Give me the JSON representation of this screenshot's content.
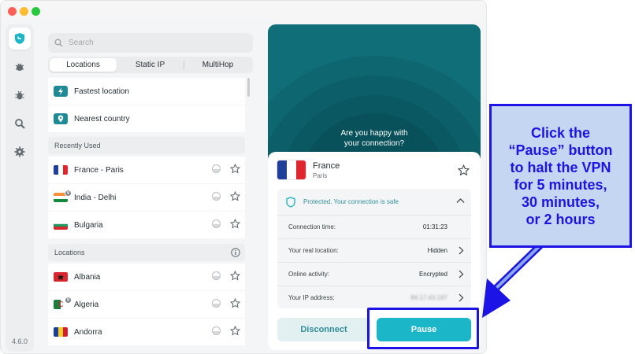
{
  "app": {
    "version": "4.6.0"
  },
  "search": {
    "placeholder": "Search",
    "value": ""
  },
  "tabs": [
    {
      "label": "Locations",
      "active": true
    },
    {
      "label": "Static IP",
      "active": false
    },
    {
      "label": "MultiHop",
      "active": false
    }
  ],
  "quick": [
    {
      "label": "Fastest location",
      "icon": "bolt-icon"
    },
    {
      "label": "Nearest country",
      "icon": "location-pin-icon"
    }
  ],
  "recently_used": {
    "header": "Recently Used",
    "items": [
      {
        "label": "France - Paris",
        "flag": "france-flag"
      },
      {
        "label": "India - Delhi",
        "flag": "india-flag",
        "virtual": "V"
      },
      {
        "label": "Bulgaria",
        "flag": "bulgaria-flag"
      }
    ]
  },
  "locations": {
    "header": "Locations",
    "items": [
      {
        "label": "Albania",
        "flag": "albania-flag"
      },
      {
        "label": "Algeria",
        "flag": "algeria-flag",
        "virtual": "V"
      },
      {
        "label": "Andorra",
        "flag": "andorra-flag"
      }
    ]
  },
  "hero": {
    "line1": "Are you happy with",
    "line2": "your connection?"
  },
  "connection": {
    "country": "France",
    "city": "Paris",
    "status": "Protected. Your connection is safe",
    "stats": [
      {
        "label": "Connection time:",
        "value": "01:31:23"
      },
      {
        "label": "Your real location:",
        "value": "Hidden"
      },
      {
        "label": "Online activity:",
        "value": "Encrypted"
      },
      {
        "label": "Your IP address:",
        "value": "84.17.43.197"
      }
    ]
  },
  "buttons": {
    "disconnect": "Disconnect",
    "pause": "Pause"
  },
  "callout": {
    "text": "Click the\n“Pause” button\nto halt the VPN\nfor 5 minutes,\n30 minutes,\nor 2 hours"
  },
  "colors": {
    "accent": "#1bb6c8",
    "hero": "#0f6e78",
    "annotation": "#1c14e6",
    "callout_bg": "#c5d6f2"
  }
}
